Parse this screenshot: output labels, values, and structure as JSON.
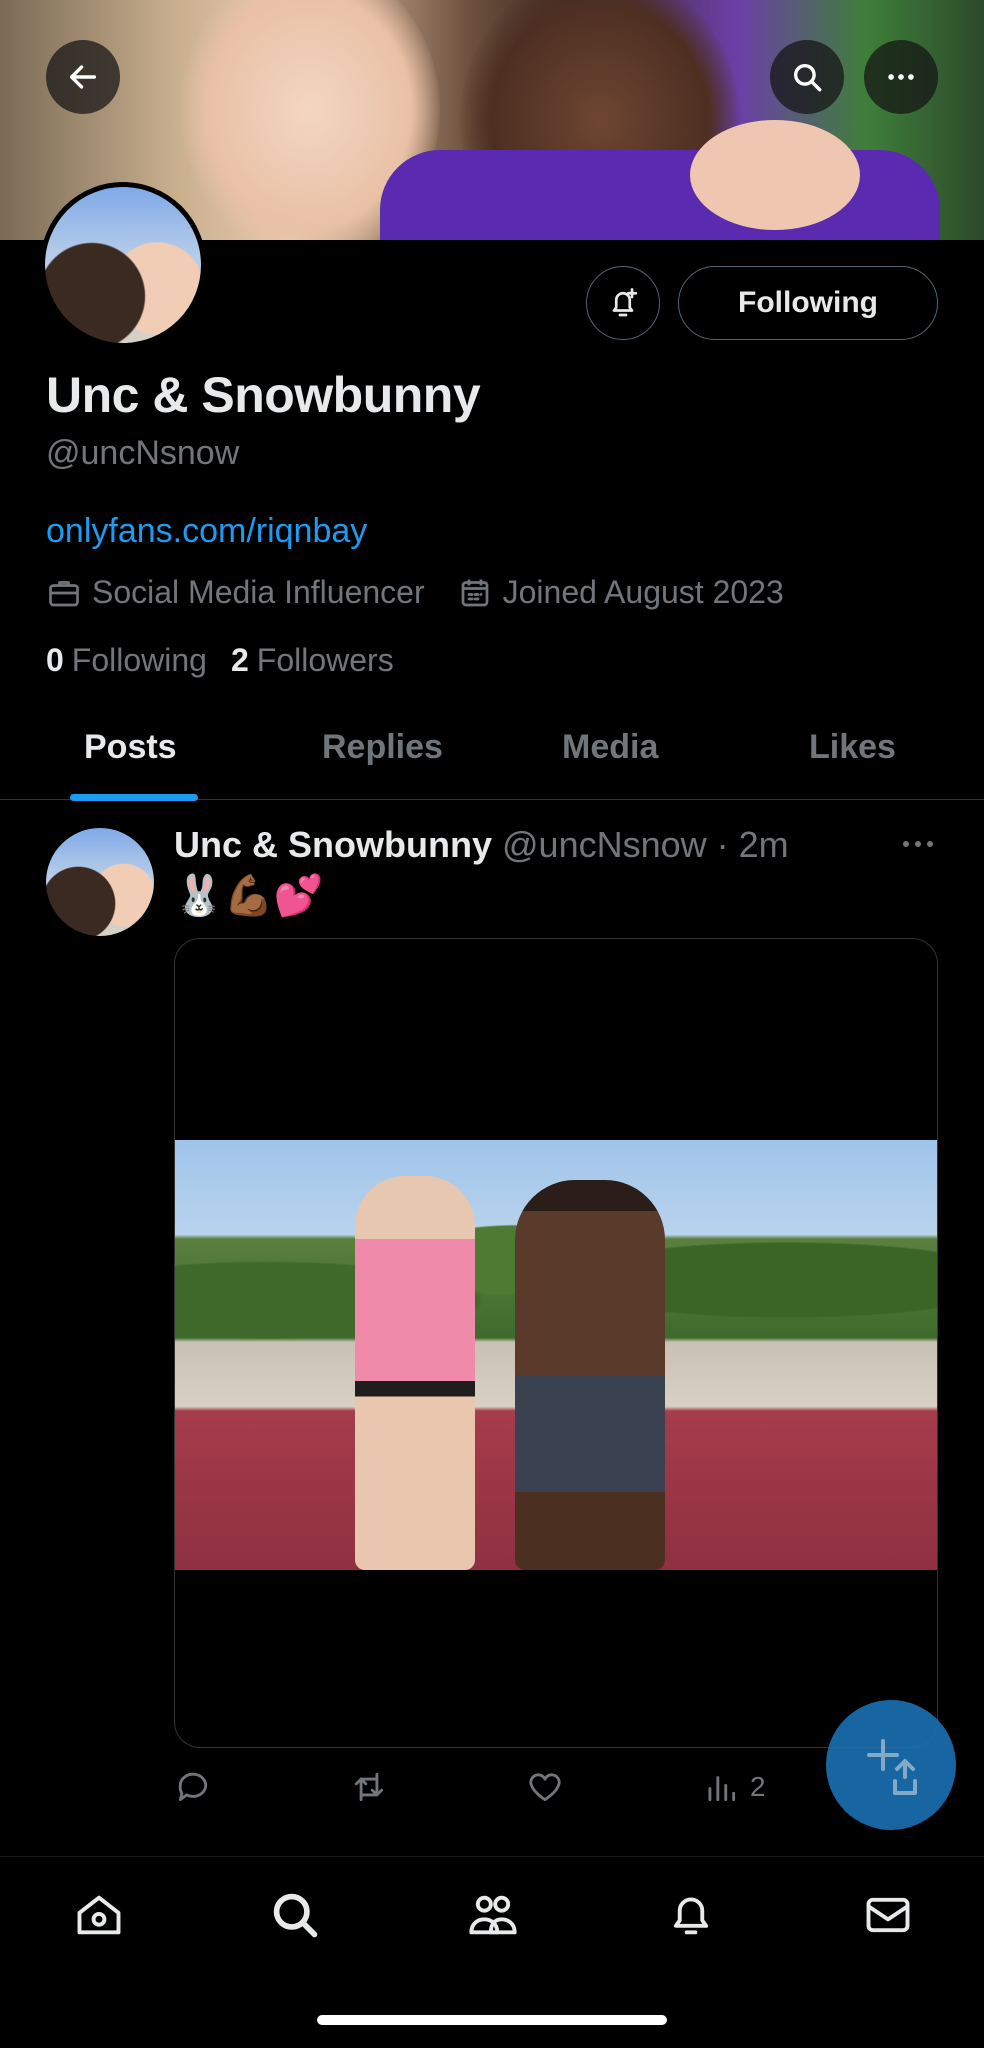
{
  "header": {
    "back_icon": "arrow-left-icon",
    "search_icon": "search-icon",
    "more_icon": "more-horizontal-icon"
  },
  "profile": {
    "name": "Unc & Snowbunny",
    "handle": "@uncNsnow",
    "link": "onlyfans.com/riqnbay",
    "category": "Social Media Influencer",
    "joined": "Joined August 2023",
    "following_count": "0",
    "following_label": "Following",
    "followers_count": "2",
    "followers_label": "Followers",
    "follow_button_label": "Following",
    "notify_icon": "bell-plus-icon"
  },
  "tabs": [
    {
      "label": "Posts",
      "active": true
    },
    {
      "label": "Replies",
      "active": false
    },
    {
      "label": "Media",
      "active": false
    },
    {
      "label": "Likes",
      "active": false
    }
  ],
  "post": {
    "author_name": "Unc & Snowbunny",
    "author_handle": "@uncNsnow · 2m",
    "text": "🐰💪🏾💕",
    "views_count": "2"
  },
  "bottom_nav": [
    "home-icon",
    "search-icon",
    "communities-icon",
    "notifications-icon",
    "messages-icon"
  ],
  "colors": {
    "accent": "#1d9bf0",
    "background": "#000000",
    "muted": "#71767b",
    "text": "#e7e9ea"
  }
}
